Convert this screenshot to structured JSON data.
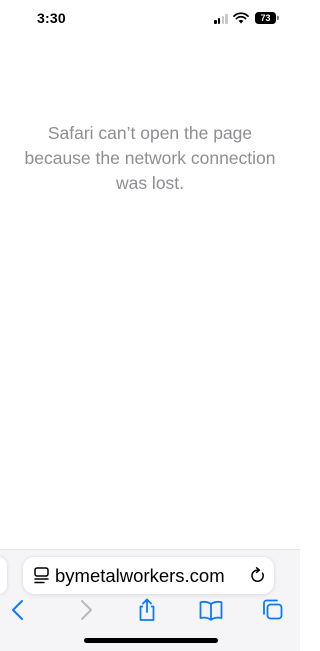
{
  "status_bar": {
    "time": "3:30",
    "battery_level": "73",
    "signal_bars_active": 2,
    "signal_bars_total": 4
  },
  "error": {
    "message": "Safari can’t open the page because the network connection was lost."
  },
  "address_bar": {
    "url": "bymetalworkers.com",
    "left_icon": "page-menu-icon",
    "right_icon": "reload-icon"
  },
  "toolbar": {
    "icons": [
      "back-icon",
      "forward-icon",
      "share-icon",
      "bookmarks-icon",
      "tabs-icon"
    ],
    "accent_color": "#0a7aff",
    "disabled_color": "#b8b8bd"
  }
}
